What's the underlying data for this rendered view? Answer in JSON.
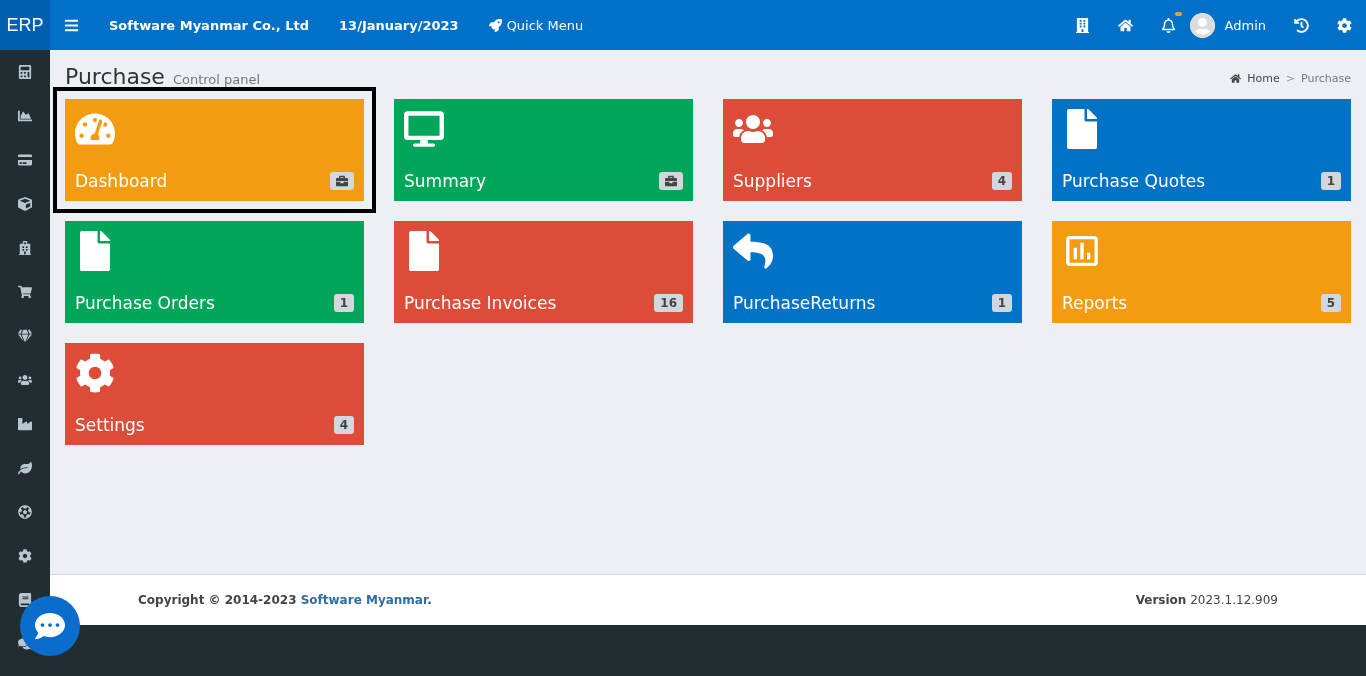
{
  "header": {
    "logo": "ERP",
    "company": "Software Myanmar Co., Ltd",
    "date": "13/January/2023",
    "quick_menu": "Quick Menu",
    "user": "Admin",
    "notification_dot": true
  },
  "page": {
    "title": "Purchase",
    "subtitle": "Control panel"
  },
  "breadcrumb_separator": ">",
  "breadcrumb": [
    {
      "label": "Home",
      "selected": false
    },
    {
      "label": "Purchase",
      "selected": true
    }
  ],
  "tiles": [
    {
      "label": "Dashboard",
      "color": "#f39c12",
      "selected": true,
      "badge": {
        "kind": "icon"
      }
    },
    {
      "label": "Summary",
      "color": "#00a65a",
      "selected": false,
      "badge": {
        "kind": "icon"
      }
    },
    {
      "label": "Suppliers",
      "color": "#dd4b39",
      "selected": false,
      "badge": {
        "kind": "count",
        "text": "4"
      }
    },
    {
      "label": "Purchase Quotes",
      "color": "#0073c7",
      "selected": false,
      "badge": {
        "kind": "count",
        "text": "1"
      }
    },
    {
      "label": "Purchase Orders",
      "color": "#00a65a",
      "selected": false,
      "badge": {
        "kind": "count",
        "text": "1"
      }
    },
    {
      "label": "Purchase Invoices",
      "color": "#dd4b39",
      "selected": false,
      "badge": {
        "kind": "count",
        "text": "16"
      }
    },
    {
      "label": "PurchaseReturns",
      "color": "#0073c7",
      "selected": false,
      "badge": {
        "kind": "count",
        "text": "1"
      }
    },
    {
      "label": "Reports",
      "color": "#f39c12",
      "selected": false,
      "badge": {
        "kind": "count",
        "text": "5"
      }
    },
    {
      "label": "Settings",
      "color": "#dd4b39",
      "selected": false,
      "badge": {
        "kind": "count",
        "text": "4"
      }
    }
  ],
  "footer": {
    "copyright": "Copyright © 2014-2023 ",
    "link": "Software Myanmar",
    "end": ".",
    "version": "**Version** 2023.1.12.909"
  }
}
